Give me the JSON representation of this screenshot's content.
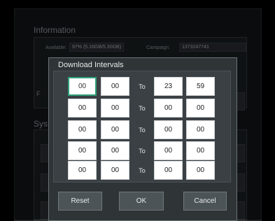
{
  "background": {
    "information_title": "Information",
    "available_label": "Available:",
    "available_value": "97% (5.16GB/5.30GB)",
    "campaign_label": "Campaign:",
    "campaign_value": "1373247741",
    "system_title": "Syst",
    "left_letter": "F"
  },
  "dialog": {
    "title": "Download Intervals",
    "to_label": "To",
    "rows": [
      {
        "start_h": "00",
        "start_m": "00",
        "end_h": "23",
        "end_m": "59"
      },
      {
        "start_h": "00",
        "start_m": "00",
        "end_h": "00",
        "end_m": "00"
      },
      {
        "start_h": "00",
        "start_m": "00",
        "end_h": "00",
        "end_m": "00"
      },
      {
        "start_h": "00",
        "start_m": "00",
        "end_h": "00",
        "end_m": "00"
      },
      {
        "start_h": "00",
        "start_m": "00",
        "end_h": "00",
        "end_m": "00"
      }
    ],
    "buttons": {
      "reset": "Reset",
      "ok": "OK",
      "cancel": "Cancel"
    }
  },
  "colors": {
    "focus": "#2fa07a",
    "dialog_bg": "#2f3437"
  }
}
